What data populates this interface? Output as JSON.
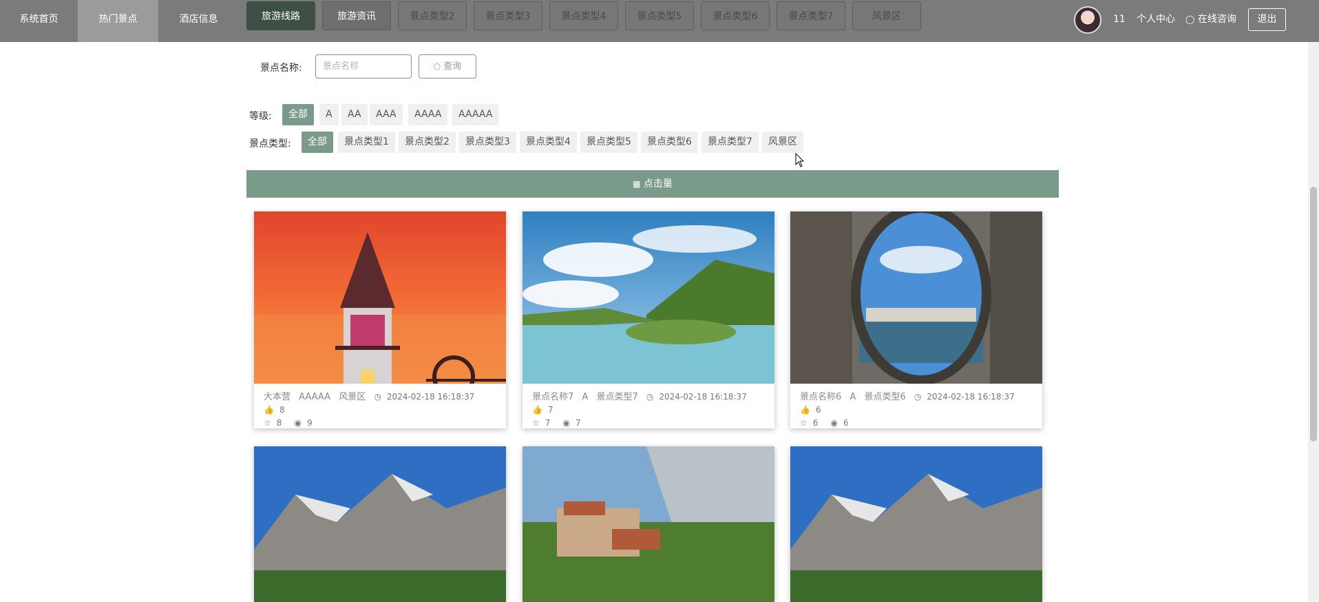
{
  "nav": {
    "home": "系统首页",
    "hot_spots": "热门景点",
    "hotel": "酒店信息",
    "routes": "旅游线路",
    "news": "旅游资讯",
    "overlay_hidden_1": "旅游线路",
    "overlay_hidden_2": "景点类型1"
  },
  "top_pills": [
    "景点类型2",
    "景点类型3",
    "景点类型4",
    "景点类型5",
    "景点类型6",
    "景点类型7",
    "风景区"
  ],
  "user": {
    "id": "11",
    "center": "个人中心",
    "consult": "在线咨询",
    "logout": "退出"
  },
  "search": {
    "label": "景点名称:",
    "placeholder": "景点名称",
    "button": "查询"
  },
  "filters": {
    "level_label": "等级:",
    "levels": [
      "全部",
      "A",
      "AA",
      "AAA",
      "AAAA",
      "AAAAA"
    ],
    "type_label": "景点类型:",
    "types": [
      "全部",
      "景点类型1",
      "景点类型2",
      "景点类型3",
      "景点类型4",
      "景点类型5",
      "景点类型6",
      "景点类型7",
      "风景区"
    ]
  },
  "sort": {
    "label": "点击量"
  },
  "colors": {
    "accent": "#7a9a8a",
    "topbar": "#7b7b7b"
  },
  "cards": [
    {
      "name": "大本营",
      "level": "AAAAA",
      "type": "风景区",
      "time": "2024-02-18 16:18:37",
      "likes": "8",
      "favorites": "8",
      "views": "9",
      "image": "sunset-lighthouse"
    },
    {
      "name": "景点名称7",
      "level": "A",
      "type": "景点类型7",
      "time": "2024-02-18 16:18:37",
      "likes": "7",
      "favorites": "7",
      "views": "7",
      "image": "lake-hills"
    },
    {
      "name": "景点名称6",
      "level": "A",
      "type": "景点类型6",
      "time": "2024-02-18 16:18:37",
      "likes": "6",
      "favorites": "6",
      "views": "6",
      "image": "arch-coast"
    },
    {
      "image": "mountains"
    },
    {
      "image": "village-cliffs"
    },
    {
      "image": "mountains"
    }
  ]
}
